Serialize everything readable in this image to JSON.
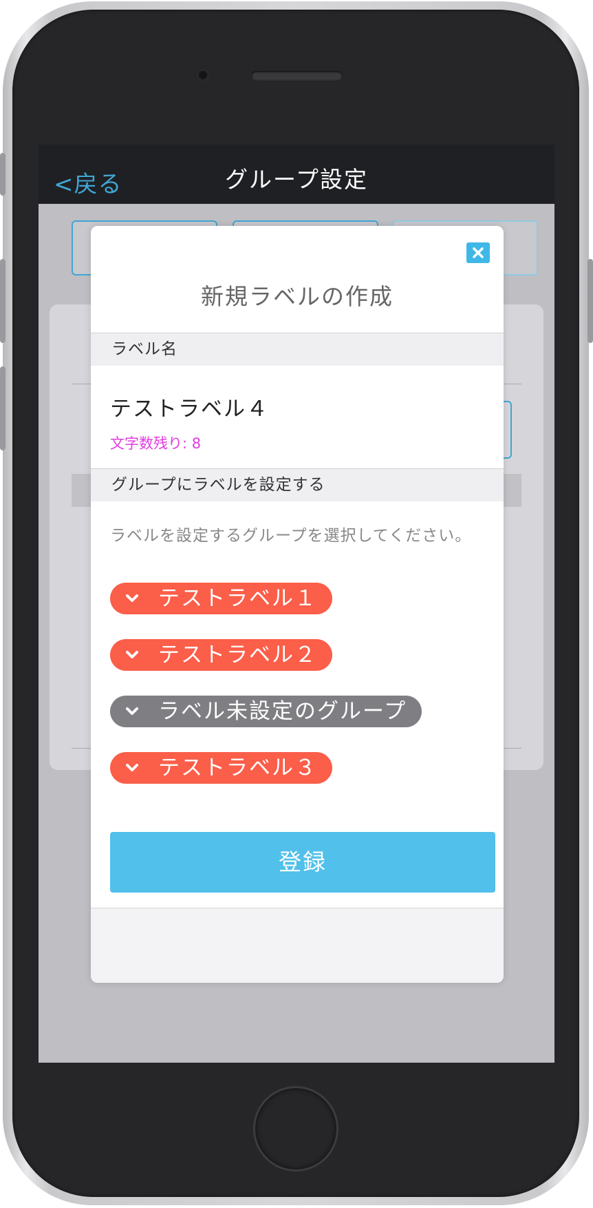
{
  "nav": {
    "back_label": "<戻る",
    "title": "グループ設定"
  },
  "modal": {
    "title": "新規ラベルの作成",
    "close_icon": "close-icon",
    "label_name_header": "ラベル名",
    "label_name_value": "テストラベル４",
    "char_remaining": "文字数残り: 8",
    "group_section_header": "グループにラベルを設定する",
    "instruction": "ラベルを設定するグループを選択してください。",
    "groups": [
      {
        "label": "テストラベル１",
        "color": "#fb5e49"
      },
      {
        "label": "テストラベル２",
        "color": "#fb5e49"
      },
      {
        "label": "ラベル未設定のグループ",
        "color": "#7f7e82"
      },
      {
        "label": "テストラベル３",
        "color": "#fb5e49"
      }
    ],
    "register_label": "登録"
  },
  "colors": {
    "accent": "#3fa6d3",
    "register": "#51c0ea",
    "char_count": "#e23ce0"
  }
}
